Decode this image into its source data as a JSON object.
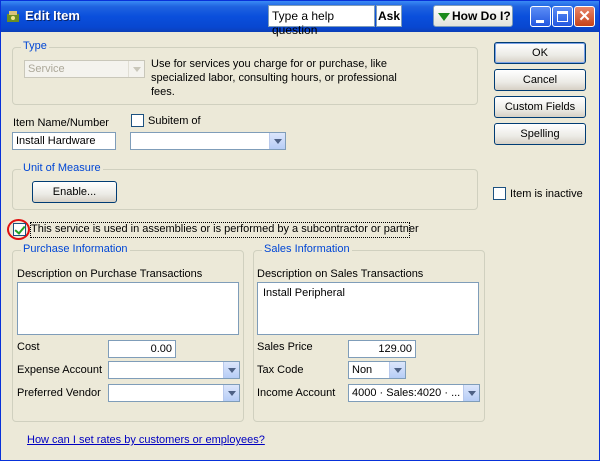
{
  "window": {
    "title": "Edit Item"
  },
  "help": {
    "question_text": "Type a help question",
    "ask_label": "Ask",
    "howdoi_label": "How Do I?"
  },
  "type_group": {
    "label": "Type",
    "selected": "Service",
    "description": "Use for services you charge for or purchase, like specialized labor, consulting hours, or professional fees."
  },
  "item": {
    "name_label": "Item Name/Number",
    "name_value": "Install Hardware",
    "subitem_label": "Subitem of",
    "subitem_value": ""
  },
  "unit_of_measure": {
    "label": "Unit of Measure",
    "enable_label": "Enable..."
  },
  "assembly_checkbox": {
    "label": "This service is used in assemblies or is performed by a subcontractor or partner",
    "checked": true
  },
  "purchase": {
    "label": "Purchase Information",
    "desc_label": "Description on Purchase Transactions",
    "desc_value": "",
    "cost_label": "Cost",
    "cost_value": "0.00",
    "expense_label": "Expense Account",
    "expense_value": "",
    "vendor_label": "Preferred Vendor",
    "vendor_value": ""
  },
  "sales": {
    "label": "Sales Information",
    "desc_label": "Description on Sales Transactions",
    "desc_value": "Install Peripheral",
    "price_label": "Sales Price",
    "price_value": "129.00",
    "tax_label": "Tax Code",
    "tax_value": "Non",
    "income_label": "Income Account",
    "income_value": "4000 · Sales:4020 · ..."
  },
  "buttons": {
    "ok": "OK",
    "cancel": "Cancel",
    "custom_fields": "Custom Fields",
    "spelling": "Spelling"
  },
  "inactive": {
    "label": "Item is inactive",
    "checked": false
  },
  "footer_link": "How can I set rates by customers or employees?",
  "colors": {
    "titlebar": "#0a4fdc",
    "group_label": "#0046d5",
    "link": "#0000c0",
    "highlight_circle": "#e01010"
  }
}
